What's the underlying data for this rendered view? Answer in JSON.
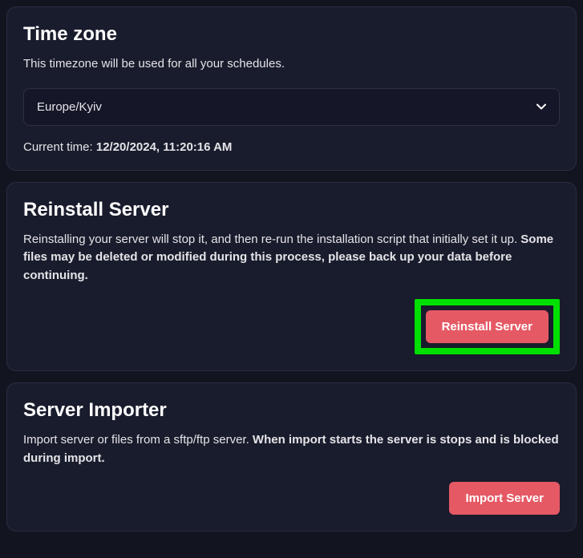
{
  "timezone": {
    "title": "Time zone",
    "description": "This timezone will be used for all your schedules.",
    "selected": "Europe/Kyiv",
    "current_time_label": "Current time: ",
    "current_time_value": "12/20/2024, 11:20:16 AM"
  },
  "reinstall": {
    "title": "Reinstall Server",
    "description_plain": "Reinstalling your server will stop it, and then re-run the installation script that initially set it up. ",
    "description_bold": "Some files may be deleted or modified during this process, please back up your data before continuing.",
    "button": "Reinstall Server"
  },
  "importer": {
    "title": "Server Importer",
    "description_plain": "Import server or files from a sftp/ftp server. ",
    "description_bold": "When import starts the server is stops and is blocked during import.",
    "button": "Import Server"
  }
}
